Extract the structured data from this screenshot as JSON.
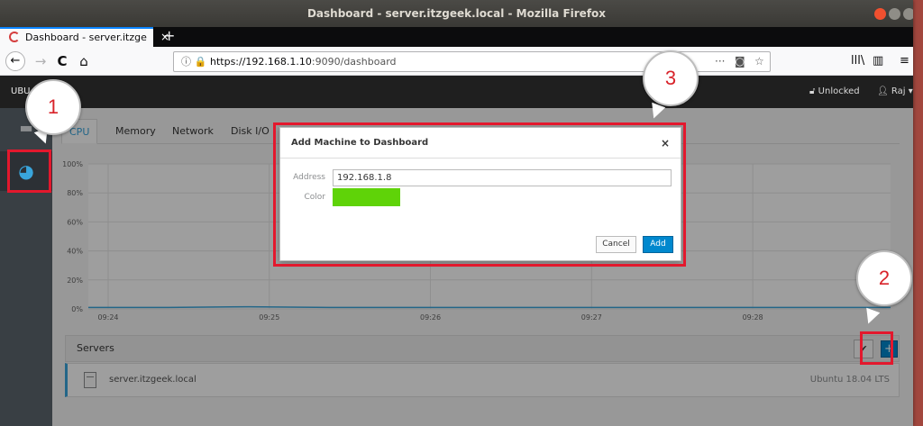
{
  "window": {
    "title": "Dashboard - server.itzgeek.local - Mozilla Firefox"
  },
  "tab": {
    "title": "Dashboard - server.itzge",
    "close": "×",
    "new": "+"
  },
  "toolbar": {
    "url_host": "https://192.168.1.10",
    "url_rest": ":9090/dashboard",
    "more": "···",
    "back": "←",
    "forward": "→",
    "reload": "C",
    "home": "⌂",
    "library": "lll\\",
    "sidebar": "▥",
    "menu": "≡"
  },
  "masthead": {
    "brand": "UBU",
    "lock_label": "Unlocked",
    "user": "Raj"
  },
  "sidebar": {
    "items": [
      {
        "icon": "host-icon"
      },
      {
        "icon": "dashboard-icon",
        "active": true
      }
    ]
  },
  "content": {
    "tabs": [
      {
        "label": "CPU",
        "active": true
      },
      {
        "label": "Memory"
      },
      {
        "label": "Network"
      },
      {
        "label": "Disk I/O"
      }
    ],
    "servers_header": "Servers",
    "servers": [
      {
        "name": "server.itzgeek.local",
        "os": "Ubuntu 18.04 LTS"
      }
    ]
  },
  "chart_data": {
    "type": "line",
    "y_ticks": [
      "100%",
      "80%",
      "60%",
      "40%",
      "20%",
      "0%"
    ],
    "x_ticks": [
      "09:24",
      "09:25",
      "09:26",
      "09:27",
      "09:28"
    ],
    "ylim": [
      0,
      100
    ],
    "series": [
      {
        "values": [
          1,
          1,
          1.5,
          1,
          1,
          1,
          1,
          1,
          1,
          1,
          1
        ]
      }
    ]
  },
  "modal": {
    "title": "Add Machine to Dashboard",
    "close": "×",
    "address_label": "Address",
    "address_value": "192.168.1.8",
    "color_label": "Color",
    "color_value": "#5fd308",
    "cancel": "Cancel",
    "add": "Add"
  },
  "annotations": {
    "callouts": [
      "1",
      "2",
      "3"
    ],
    "highlight_color": "#e3182d"
  }
}
